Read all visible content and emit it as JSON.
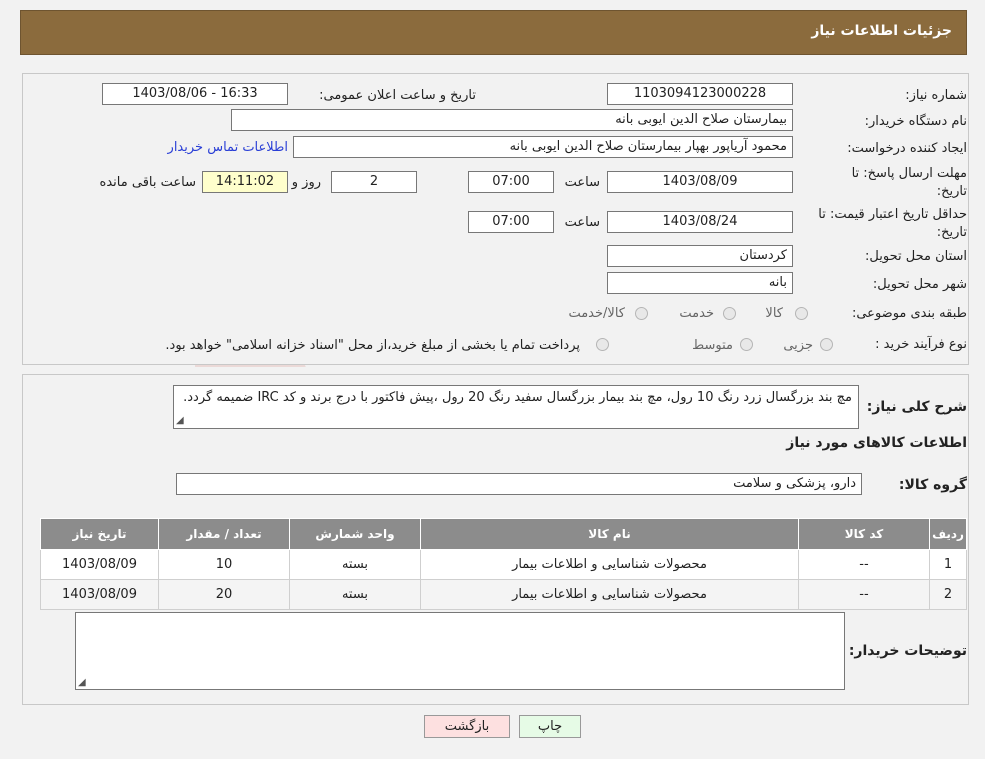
{
  "header": {
    "title": "جزئیات اطلاعات نیاز"
  },
  "form": {
    "need_number_label": "شماره نیاز:",
    "need_number": "1103094123000228",
    "announce_label": "تاریخ و ساعت اعلان عمومی:",
    "announce_value": "1403/08/06 - 16:33",
    "buyer_org_label": "نام دستگاه خریدار:",
    "buyer_org": "بیمارستان صلاح الدین ایوبی بانه",
    "requester_label": "ایجاد کننده درخواست:",
    "requester": "محمود آریاپور بهپار بیمارستان صلاح الدین ایوبی بانه",
    "contact_link": "اطلاعات تماس خریدار",
    "deadline_label_1": "مهلت ارسال پاسخ: تا",
    "deadline_label_2": "تاریخ:",
    "deadline_date": "1403/08/09",
    "time_label": "ساعت",
    "deadline_time": "07:00",
    "days_value": "2",
    "days_label": "روز و",
    "remaining_time": "14:11:02",
    "remaining_label": "ساعت باقی مانده",
    "validity_label_1": "حداقل تاریخ اعتبار قیمت: تا",
    "validity_label_2": "تاریخ:",
    "validity_date": "1403/08/24",
    "validity_time": "07:00",
    "province_label": "استان محل تحویل:",
    "province": "کردستان",
    "city_label": "شهر محل تحویل:",
    "city": "بانه",
    "category_label": "طبقه بندی موضوعی:",
    "category_options": [
      "کالا",
      "خدمت",
      "کالا/خدمت"
    ],
    "process_label": "نوع فرآیند خرید :",
    "process_options": [
      "جزیی",
      "متوسط"
    ],
    "payment_note": "پرداخت تمام یا بخشی از مبلغ خرید،از محل \"اسناد خزانه اسلامی\" خواهد بود."
  },
  "details": {
    "desc_label": "شرح کلی نیاز:",
    "description": "مچ بند بزرگسال زرد رنگ 10 رول، مچ بند بیمار بزرگسال سفید رنگ 20 رول ،پیش فاکتور با درج برند و کد IRC ضمیمه گردد.",
    "goods_info_title": "اطلاعات کالاهای مورد نیاز",
    "goods_group_label": "گروه کالا:",
    "goods_group": "دارو، پزشکی و سلامت"
  },
  "table": {
    "headers": [
      "ردیف",
      "کد کالا",
      "نام کالا",
      "واحد شمارش",
      "تعداد / مقدار",
      "تاریخ نیاز"
    ],
    "rows": [
      [
        "1",
        "--",
        "محصولات شناسایی و اطلاعات بیمار",
        "بسته",
        "10",
        "1403/08/09"
      ],
      [
        "2",
        "--",
        "محصولات شناسایی و اطلاعات بیمار",
        "بسته",
        "20",
        "1403/08/09"
      ]
    ]
  },
  "notes_label": "توضیحات خریدار:",
  "buttons": {
    "print": "چاپ",
    "back": "بازگشت"
  }
}
